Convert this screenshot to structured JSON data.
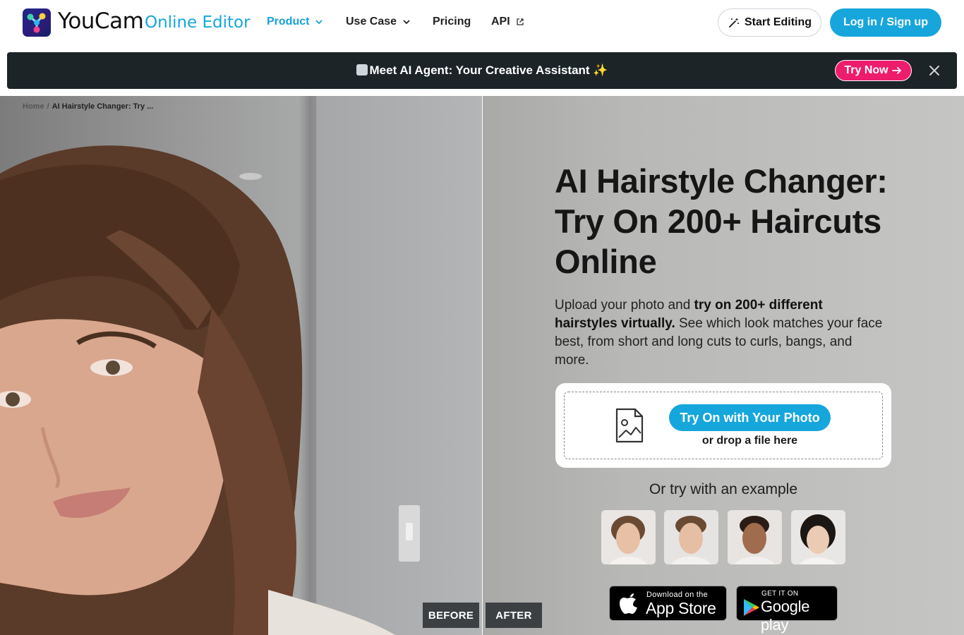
{
  "header": {
    "brand": "YouCam",
    "brand_sub": "Online Editor",
    "nav": [
      {
        "label": "Product"
      },
      {
        "label": "Use Case"
      },
      {
        "label": "Pricing"
      },
      {
        "label": "API"
      }
    ],
    "start_label": "Start Editing",
    "login_label": "Log in / Sign up"
  },
  "banner": {
    "text": "Meet AI Agent: Your Creative Assistant ✨",
    "try_now": "Try Now"
  },
  "breadcrumb": {
    "home": "Home",
    "separator": "/",
    "current": "AI Hairstyle Changer: Try ..."
  },
  "compare": {
    "before": "BEFORE",
    "after": "AFTER"
  },
  "hero": {
    "title": "AI Hairstyle Changer: Try On 200+ Haircuts Online",
    "desc_1": "Upload your photo and ",
    "desc_bold": "try on 200+ different hairstyles virtually.",
    "desc_2": " See which look matches your face best, from short and long cuts to curls, bangs, and more.",
    "upload_button": "Try On with Your Photo",
    "drop_text": "or drop a file here",
    "example_title": "Or try with an example"
  },
  "stores": {
    "apple_small": "Download on the",
    "apple_big": "App Store",
    "google_small": "GET IT ON",
    "google_big": "Google play"
  },
  "colors": {
    "accent": "#16a6dc",
    "banner_bg": "#1c2428",
    "try_now": "#ee1c6c"
  }
}
